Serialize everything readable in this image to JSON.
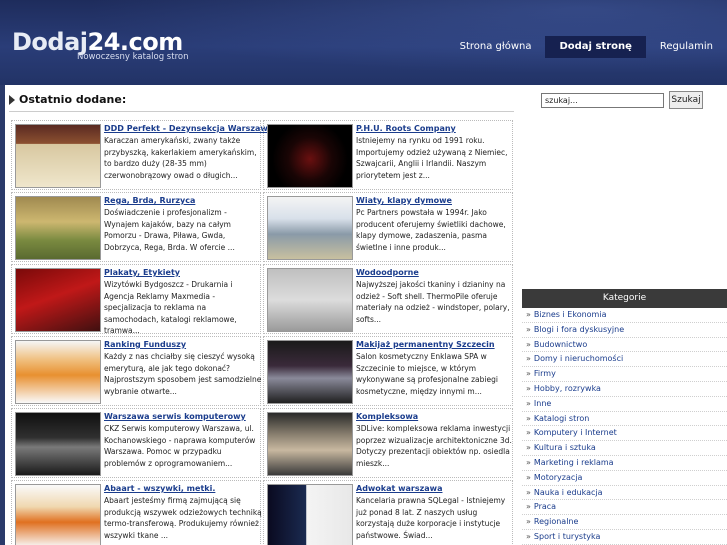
{
  "header": {
    "logo_text": "Dodaj",
    "logo_num": "24.com",
    "tagline": "Nowoczesny katalog stron",
    "nav": [
      "Strona główna",
      "Dodaj stronę",
      "Regulamin"
    ]
  },
  "section": {
    "title": "Ostatnio dodane:"
  },
  "search": {
    "value": "szukaj...",
    "button": "Szukaj"
  },
  "listings": [
    {
      "title": "DDD Perfekt - Dezynsekcja Warszawa",
      "desc": "Karaczan amerykański, zwany także przybyszką, kakerlakiem amerykańskim, to bardzo duży (28-35 mm) czerwonobrązowy owad o długich..."
    },
    {
      "title": "P.H.U. Roots Company",
      "desc": "Istniejemy na rynku od 1991 roku. Importujemy odzież używaną z Niemiec, Szwajcarii, Anglii i Irlandii. Naszym priorytetem jest z..."
    },
    {
      "title": "Rega, Brda, Rurzyca",
      "desc": "Doświadczenie i profesjonalizm - Wynajem kajaków, bazy na całym Pomorzu - Drawa, Piława, Gwda, Dobrzyca, Rega, Brda. W ofercie ..."
    },
    {
      "title": "Wiaty, klapy dymowe",
      "desc": "Pc Partners powstała w 1994r. Jako producent oferujemy świetliki dachowe, klapy dymowe, zadaszenia, pasma świetlne i inne produk..."
    },
    {
      "title": "Plakaty, Etykiety",
      "desc": "Wizytówki Bydgoszcz - Drukarnia i Agencja Reklamy Maxmedia - specjalizacja to reklama na samochodach, katalogi reklamowe, tramwa..."
    },
    {
      "title": "Wodoodporne",
      "desc": "Najwyższej jakości tkaniny i dzianiny na odzież - Soft shell. ThermoPile oferuje materiały na odzież - windstoper, polary, softs..."
    },
    {
      "title": "Ranking Funduszy",
      "desc": "Każdy z nas chciałby się cieszyć wysoką emeryturą, ale jak tego dokonać? Najprostszym sposobem jest samodzielne wybranie otwarte..."
    },
    {
      "title": "Makijaż permanentny Szczecin",
      "desc": "Salon kosmetyczny Enklawa SPA w Szczecinie to miejsce, w którym wykonywane są profesjonalne zabiegi kosmetyczne, między innymi m..."
    },
    {
      "title": "Warszawa serwis komputerowy",
      "desc": "CKZ Serwis komputerowy Warszawa, ul. Kochanowskiego - naprawa komputerów Warszawa. Pomoc w przypadku problemów z oprogramowaniem..."
    },
    {
      "title": "Kompleksowa",
      "desc": "3DLive: kompleksowa reklama inwestycji poprzez wizualizacje architektoniczne 3d. Dotyczy prezentacji obiektów np. osiedla mieszk..."
    },
    {
      "title": "Abaart - wszywki, metki.",
      "desc": "Abaart jesteśmy firmą zajmującą się produkcją wszywek odzieżowych techniką termo-transferową. Produkujemy również wszywki tkane ..."
    },
    {
      "title": "Adwokat warszawa",
      "desc": "Kancelaria prawna SQLegal - Istniejemy już ponad 8 lat. Z naszych usług korzystają duże korporacje i instytucje państwowe. Świad..."
    }
  ],
  "categories": {
    "title": "Kategorie",
    "items": [
      "Biznes i Ekonomia",
      "Blogi i fora dyskusyjne",
      "Budownictwo",
      "Domy i nieruchomości",
      "Firmy",
      "Hobby, rozrywka",
      "Inne",
      "Katalogi stron",
      "Komputery i Internet",
      "Kultura i sztuka",
      "Marketing i reklama",
      "Motoryzacja",
      "Nauka i edukacja",
      "Praca",
      "Regionalne",
      "Sport i turystyka"
    ]
  },
  "colors": {
    "header": "#223366",
    "link": "#1a3c8c",
    "cat_head": "#3a3a3a"
  }
}
